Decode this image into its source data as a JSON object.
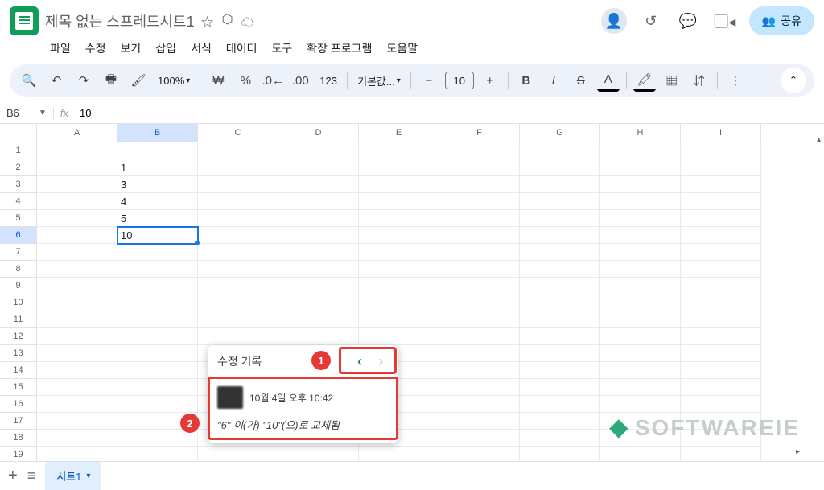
{
  "header": {
    "title": "제목 없는 스프레드시트1",
    "share_label": "공유"
  },
  "menu": [
    "파일",
    "수정",
    "보기",
    "삽입",
    "서식",
    "데이터",
    "도구",
    "확장 프로그램",
    "도움말"
  ],
  "toolbar": {
    "zoom": "100%",
    "currency": "₩",
    "percent": "%",
    "numfmt": "123",
    "font": "기본값...",
    "fontsize": "10"
  },
  "namebox": "B6",
  "formula": "10",
  "columns": [
    "A",
    "B",
    "C",
    "D",
    "E",
    "F",
    "G",
    "H",
    "I"
  ],
  "rows": [
    1,
    2,
    3,
    4,
    5,
    6,
    7,
    8,
    9,
    10,
    11,
    12,
    13,
    14,
    15,
    16,
    17,
    18,
    19
  ],
  "cells": {
    "B2": "1",
    "B3": "3",
    "B4": "4",
    "B5": "5",
    "B6": "10"
  },
  "selected": {
    "row": 6,
    "col": "B"
  },
  "popup": {
    "title": "수정 기록",
    "timestamp": "10월 4일 오후 10:42",
    "change": "\"6\" 이(가) \"10\"(으)로 교체됨"
  },
  "annotations": {
    "1": "1",
    "2": "2"
  },
  "sheet_tab": "시트1",
  "watermark": "SOFTWAREIE"
}
